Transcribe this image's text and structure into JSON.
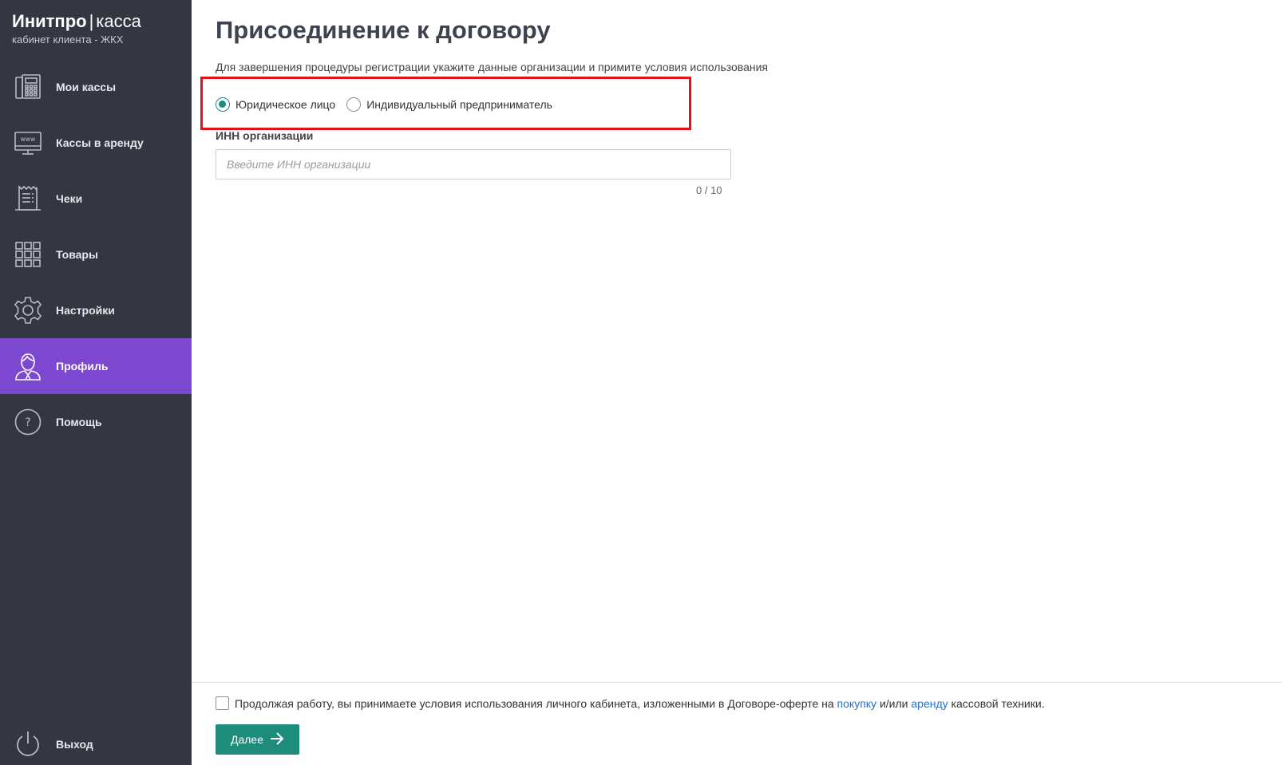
{
  "brand": {
    "name": "Инитпро",
    "separator": "|",
    "product": "касса",
    "subtitle": "кабинет клиента - ЖКХ"
  },
  "nav": {
    "items": [
      {
        "label": "Мои кассы",
        "icon": "cash-register-icon",
        "active": false
      },
      {
        "label": "Кассы в аренду",
        "icon": "monitor-www-icon",
        "active": false
      },
      {
        "label": "Чеки",
        "icon": "receipt-icon",
        "active": false
      },
      {
        "label": "Товары",
        "icon": "grid-icon",
        "active": false
      },
      {
        "label": "Настройки",
        "icon": "gear-icon",
        "active": false
      },
      {
        "label": "Профиль",
        "icon": "user-icon",
        "active": true
      },
      {
        "label": "Помощь",
        "icon": "question-icon",
        "active": false
      }
    ],
    "logout": {
      "label": "Выход",
      "icon": "power-icon"
    }
  },
  "main": {
    "title": "Присоединение к договору",
    "description": "Для завершения процедуры регистрации укажите данные организации и примите условия использования",
    "entity_type": {
      "options": [
        {
          "label": "Юридическое лицо",
          "checked": true
        },
        {
          "label": "Индивидуальный предприниматель",
          "checked": false
        }
      ]
    },
    "inn": {
      "label": "ИНН организации",
      "placeholder": "Введите ИНН организации",
      "value": "",
      "counter": "0 / 10"
    },
    "agreement": {
      "checked": false,
      "text_before": "Продолжая работу, вы принимаете условия использования личного кабинета, изложенными в Договоре-оферте на ",
      "link_purchase": "покупку",
      "text_middle": " и/или ",
      "link_rent": "аренду",
      "text_after": " кассовой техники."
    },
    "next_button": "Далее"
  },
  "colors": {
    "sidebar_bg": "#343741",
    "active_item": "#7c48cf",
    "accent_green": "#1d8c7a",
    "highlight_red": "#e0121b",
    "link_blue": "#2a6fc9"
  }
}
